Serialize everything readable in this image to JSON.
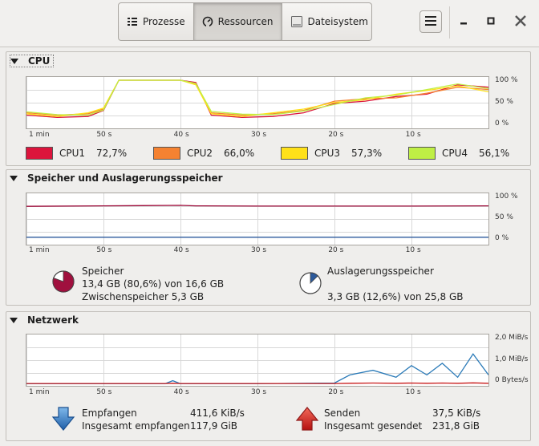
{
  "window": {
    "tabs": [
      {
        "label": "Prozesse",
        "icon": "list-icon"
      },
      {
        "label": "Ressourcen",
        "icon": "gauge-icon"
      },
      {
        "label": "Dateisystem",
        "icon": "drive-icon"
      }
    ],
    "active_tab": "Ressourcen"
  },
  "x_ticks": [
    "1 min",
    "50 s",
    "40 s",
    "30 s",
    "20 s",
    "10 s"
  ],
  "cpu": {
    "title": "CPU",
    "y_ticks": [
      "100 %",
      "50 %",
      "0 %"
    ],
    "legend": [
      {
        "name": "CPU1",
        "value": "72,7%",
        "color": "#dc143c"
      },
      {
        "name": "CPU2",
        "value": "66,0%",
        "color": "#f58231"
      },
      {
        "name": "CPU3",
        "value": "57,3%",
        "color": "#ffe119"
      },
      {
        "name": "CPU4",
        "value": "56,1%",
        "color": "#bfef45"
      }
    ]
  },
  "memory": {
    "title": "Speicher und Auslagerungsspeicher",
    "y_ticks": [
      "100 %",
      "50 %",
      "0 %"
    ],
    "ram": {
      "label": "Speicher",
      "line1": "13,4 GB (80,6%) von 16,6 GB",
      "line2": "Zwischenspeicher 5,3 GB",
      "fraction": 0.806,
      "color": "#a0103e"
    },
    "swap": {
      "label": "Auslagerungsspeicher",
      "line1": "3,3 GB (12,6%) von 25,8 GB",
      "fraction": 0.126,
      "color": "#2c5a9c"
    }
  },
  "network": {
    "title": "Netzwerk",
    "y_ticks": [
      "2,0 MiB/s",
      "1,0 MiB/s",
      "0 Bytes/s"
    ],
    "recv_label": "Empfangen",
    "recv_value": "411,6 KiB/s",
    "recv_total_label": "Insgesamt empfangen",
    "recv_total_value": "117,9 GiB",
    "send_label": "Senden",
    "send_value": "37,5 KiB/s",
    "send_total_label": "Insgesamt gesendet",
    "send_total_value": "231,8 GiB",
    "recv_color": "#2a7ab8",
    "send_color": "#c81a1a"
  },
  "chart_data": [
    {
      "type": "line",
      "title": "CPU",
      "x": [
        60,
        56,
        52,
        50,
        48,
        44,
        40,
        38,
        36,
        32,
        28,
        24,
        20,
        16,
        12,
        8,
        4,
        0
      ],
      "ylim": [
        0,
        100
      ],
      "series": [
        {
          "name": "CPU1",
          "values": [
            25,
            20,
            22,
            35,
            100,
            100,
            100,
            95,
            25,
            20,
            22,
            30,
            50,
            55,
            65,
            70,
            90,
            85
          ]
        },
        {
          "name": "CPU2",
          "values": [
            30,
            25,
            28,
            38,
            100,
            100,
            100,
            92,
            30,
            25,
            28,
            35,
            55,
            60,
            62,
            72,
            85,
            80
          ]
        },
        {
          "name": "CPU3",
          "values": [
            28,
            22,
            30,
            40,
            100,
            100,
            100,
            90,
            28,
            22,
            30,
            38,
            52,
            58,
            70,
            78,
            88,
            75
          ]
        },
        {
          "name": "CPU4",
          "values": [
            32,
            26,
            25,
            36,
            100,
            100,
            100,
            93,
            33,
            27,
            26,
            34,
            48,
            62,
            68,
            80,
            92,
            82
          ]
        }
      ]
    },
    {
      "type": "line",
      "title": "Speicher und Auslagerungsspeicher",
      "x": [
        60,
        50,
        45,
        40,
        38,
        30,
        20,
        10,
        0
      ],
      "ylim": [
        0,
        100
      ],
      "series": [
        {
          "name": "Speicher",
          "values": [
            79,
            80,
            80.5,
            81,
            80,
            79.5,
            79.5,
            79.5,
            80
          ]
        },
        {
          "name": "Auslagerungsspeicher",
          "values": [
            12.6,
            12.6,
            12.6,
            12.6,
            12.6,
            12.6,
            12.6,
            12.6,
            12.6
          ]
        }
      ]
    },
    {
      "type": "line",
      "title": "Netzwerk",
      "x": [
        60,
        50,
        42,
        41,
        40,
        30,
        20,
        18,
        15,
        12,
        10,
        8,
        6,
        4,
        2,
        0
      ],
      "ylim": [
        0,
        2.0
      ],
      "series": [
        {
          "name": "Empfangen",
          "values": [
            0.02,
            0.02,
            0.02,
            0.15,
            0.02,
            0.02,
            0.05,
            0.4,
            0.6,
            0.3,
            0.8,
            0.4,
            0.9,
            0.3,
            1.3,
            0.4
          ]
        },
        {
          "name": "Senden",
          "values": [
            0.03,
            0.03,
            0.03,
            0.04,
            0.03,
            0.03,
            0.03,
            0.04,
            0.05,
            0.04,
            0.05,
            0.04,
            0.05,
            0.04,
            0.06,
            0.04
          ]
        }
      ]
    }
  ]
}
